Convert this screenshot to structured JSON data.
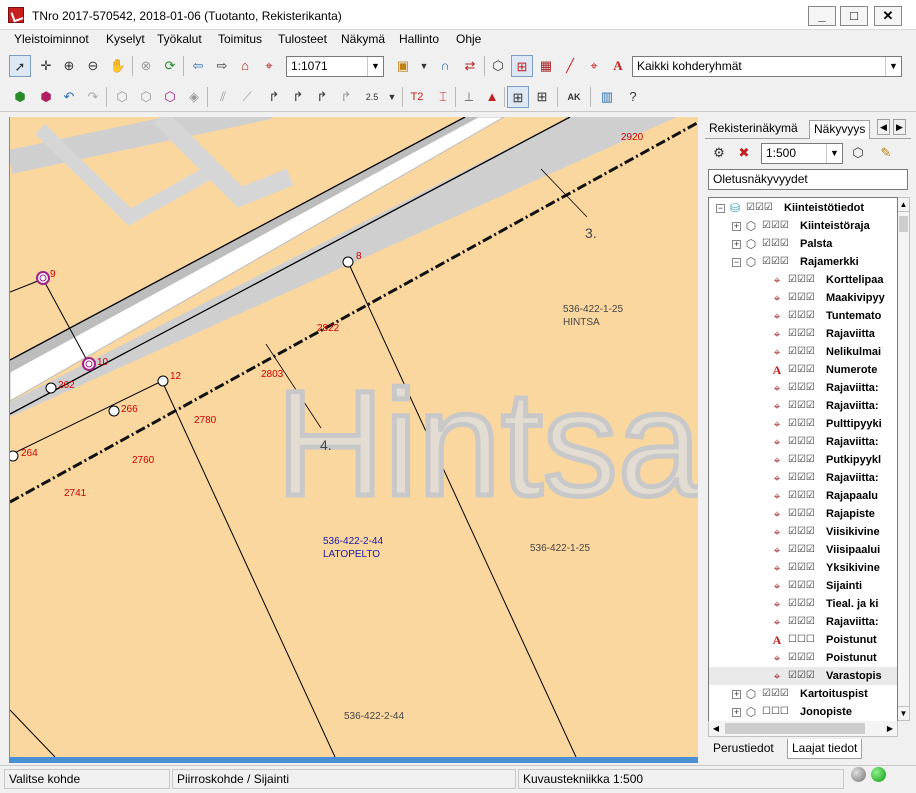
{
  "window": {
    "title": "TNro 2017-570542, 2018-01-06 (Tuotanto, Rekisterikanta)",
    "minimize": "_",
    "maximize": "□",
    "close": "✕"
  },
  "menu": [
    "Yleistoiminnot",
    "Kyselyt",
    "Työkalut",
    "Toimitus",
    "Tulosteet",
    "Näkymä",
    "Hallinto",
    "Ohje"
  ],
  "toolbar1": {
    "scale_value": "1:1071",
    "group_value": "Kaikki kohderyhmät"
  },
  "toolbar2": {
    "text_tool_label": "T2",
    "ak_label": "AK"
  },
  "map": {
    "watermark": "Hintsa",
    "markers": [
      {
        "label": "9",
        "type": "circle-magenta"
      },
      {
        "label": "10",
        "type": "circle-magenta"
      },
      {
        "label": "262",
        "type": "circle"
      },
      {
        "label": "266",
        "type": "circle"
      },
      {
        "label": "264",
        "type": "circle"
      },
      {
        "label": "12",
        "type": "circle"
      },
      {
        "label": "8",
        "type": "circle"
      }
    ],
    "numbers": [
      "2920",
      "2822",
      "2803",
      "2780",
      "2760",
      "2741"
    ],
    "boundary_labels": [
      "3.",
      "4."
    ],
    "parcels": [
      {
        "id": "536-422-1-25",
        "name": "HINTSA"
      },
      {
        "id": "536-422-2-44",
        "name": "LATOPELTO"
      },
      {
        "id": "536-422-1-25",
        "name": ""
      },
      {
        "id": "536-422-2-44",
        "name": ""
      }
    ]
  },
  "panel": {
    "tabs_top": [
      "Rekisterinäkymä",
      "Näkyvyys"
    ],
    "scale_value": "1:500",
    "view_name": "Oletusnäkyvyydet",
    "tree": [
      {
        "label": "Kiinteistötiedot",
        "level": 0,
        "expander": "−",
        "icon": "cylinder",
        "checks": "☑☑☑"
      },
      {
        "label": "Kiinteistöraja",
        "level": 1,
        "expander": "+",
        "icon": "cube",
        "checks": "☑☑☑"
      },
      {
        "label": "Palsta",
        "level": 1,
        "expander": "+",
        "icon": "cube",
        "checks": "☑☑☑"
      },
      {
        "label": "Rajamerkki",
        "level": 1,
        "expander": "−",
        "icon": "cube",
        "checks": "☑☑☑"
      },
      {
        "label": "Korttelipaa",
        "level": 2,
        "expander": "",
        "icon": "target",
        "checks": "☑☑☑"
      },
      {
        "label": "Maakivipyy",
        "level": 2,
        "expander": "",
        "icon": "target",
        "checks": "☑☑☑"
      },
      {
        "label": "Tuntemato",
        "level": 2,
        "expander": "",
        "icon": "target",
        "checks": "☑☑☑"
      },
      {
        "label": "Rajaviitta",
        "level": 2,
        "expander": "",
        "icon": "target",
        "checks": "☑☑☑"
      },
      {
        "label": "Nelikulmai",
        "level": 2,
        "expander": "",
        "icon": "target",
        "checks": "☑☑☑"
      },
      {
        "label": "Numerote",
        "level": 2,
        "expander": "",
        "icon": "text-A",
        "checks": "☑☑☑"
      },
      {
        "label": "Rajaviitta:",
        "level": 2,
        "expander": "",
        "icon": "target",
        "checks": "☑☑☑"
      },
      {
        "label": "Rajaviitta:",
        "level": 2,
        "expander": "",
        "icon": "target",
        "checks": "☑☑☑"
      },
      {
        "label": "Pulttipyyki",
        "level": 2,
        "expander": "",
        "icon": "target",
        "checks": "☑☑☑"
      },
      {
        "label": "Rajaviitta:",
        "level": 2,
        "expander": "",
        "icon": "target",
        "checks": "☑☑☑"
      },
      {
        "label": "Putkipyykl",
        "level": 2,
        "expander": "",
        "icon": "target",
        "checks": "☑☑☑"
      },
      {
        "label": "Rajaviitta:",
        "level": 2,
        "expander": "",
        "icon": "target",
        "checks": "☑☑☑"
      },
      {
        "label": "Rajapaalu",
        "level": 2,
        "expander": "",
        "icon": "target",
        "checks": "☑☑☑"
      },
      {
        "label": "Rajapiste",
        "level": 2,
        "expander": "",
        "icon": "target",
        "checks": "☑☑☑"
      },
      {
        "label": "Viisikivine",
        "level": 2,
        "expander": "",
        "icon": "target",
        "checks": "☑☑☑"
      },
      {
        "label": "Viisipaalui",
        "level": 2,
        "expander": "",
        "icon": "target",
        "checks": "☑☑☑"
      },
      {
        "label": "Yksikivine",
        "level": 2,
        "expander": "",
        "icon": "target",
        "checks": "☑☑☑"
      },
      {
        "label": "Sijainti",
        "level": 2,
        "expander": "",
        "icon": "target",
        "checks": "☑☑☑"
      },
      {
        "label": "Tieal. ja ki",
        "level": 2,
        "expander": "",
        "icon": "target",
        "checks": "☑☑☑"
      },
      {
        "label": "Rajaviitta:",
        "level": 2,
        "expander": "",
        "icon": "target",
        "checks": "☑☑☑"
      },
      {
        "label": "Poistunut",
        "level": 2,
        "expander": "",
        "icon": "text-A",
        "checks": "☐☐☐"
      },
      {
        "label": "Poistunut",
        "level": 2,
        "expander": "",
        "icon": "target",
        "checks": "☑☑☑"
      },
      {
        "label": "Varastopis",
        "level": 2,
        "expander": "",
        "icon": "target",
        "checks": "☑☑☑"
      },
      {
        "label": "Kartoituspist",
        "level": 1,
        "expander": "+",
        "icon": "cube",
        "checks": "☑☑☑"
      },
      {
        "label": "Jonopiste",
        "level": 1,
        "expander": "+",
        "icon": "cube",
        "checks": "☐☐☐"
      }
    ],
    "tabs_bottom": [
      "Perustiedot",
      "Laajat tiedot"
    ]
  },
  "status": {
    "left": "Valitse kohde",
    "middle": "Piirroskohde / Sijainti",
    "right": "Kuvaustekniikka 1:500"
  },
  "colors": {
    "map_background": "#fbd7a0",
    "road_fill": "#ffffff",
    "label_red": "#cc0000",
    "label_blue": "#1a1aa0",
    "marker_magenta": "#a0208a"
  }
}
